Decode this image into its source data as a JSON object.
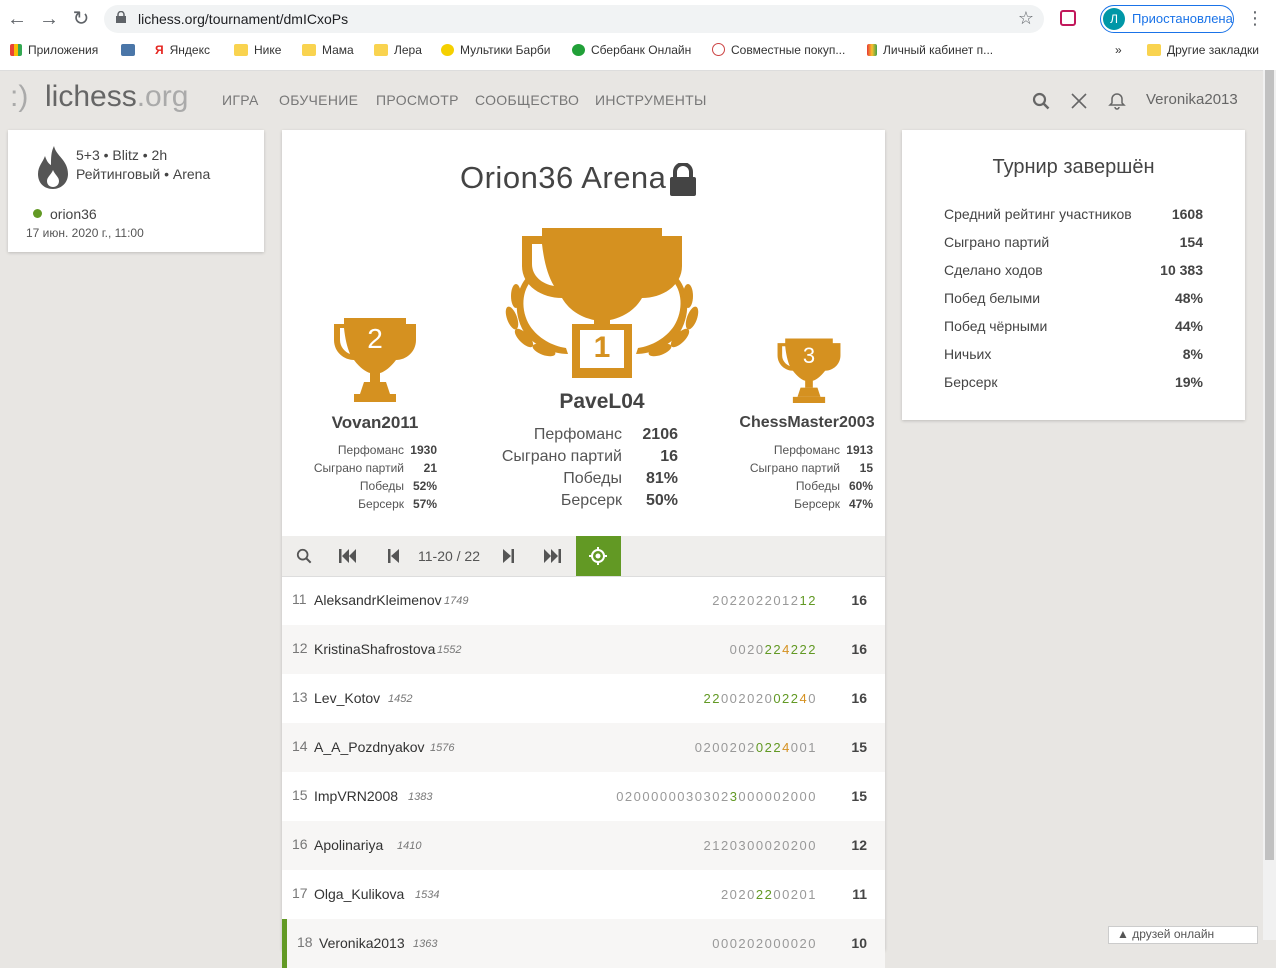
{
  "browser": {
    "url": "lichess.org/tournament/dmICxoPs",
    "profile_initial": "Л",
    "profile_label": "Приостановлена",
    "bookmarks": [
      "Приложения",
      "Яндекс",
      "Нике",
      "Мама",
      "Лера",
      "Мультики Барби",
      "Сбербанк Онлайн",
      "Совместные покуп...",
      "Личный кабинет п...",
      "»",
      "Другие закладки"
    ]
  },
  "site": {
    "logo_smile": ":)",
    "logo_main": "lichess",
    "logo_suffix": ".org",
    "nav": [
      "ИГРА",
      "ОБУЧЕНИЕ",
      "ПРОСМОТР",
      "СООБЩЕСТВО",
      "ИНСТРУМЕНТЫ"
    ],
    "username": "Veronika2013"
  },
  "info": {
    "line1": "5+3 • Blitz • 2h",
    "line2": "Рейтинговый • Arena",
    "creator": "orion36",
    "date": "17 июн. 2020 г., 11:00"
  },
  "tournament": {
    "title": "Orion36 Arena",
    "podium": [
      {
        "place": "1",
        "name": "PaveL04",
        "stats": [
          [
            "Перфоманс",
            "2106"
          ],
          [
            "Сыграно партий",
            "16"
          ],
          [
            "Победы",
            "81%"
          ],
          [
            "Берсерк",
            "50%"
          ]
        ]
      },
      {
        "place": "2",
        "name": "Vovan2011",
        "stats": [
          [
            "Перфоманс",
            "1930"
          ],
          [
            "Сыграно партий",
            "21"
          ],
          [
            "Победы",
            "52%"
          ],
          [
            "Берсерк",
            "57%"
          ]
        ]
      },
      {
        "place": "3",
        "name": "ChessMaster2003",
        "stats": [
          [
            "Перфоманс",
            "1913"
          ],
          [
            "Сыграно партий",
            "15"
          ],
          [
            "Победы",
            "60%"
          ],
          [
            "Берсерк",
            "47%"
          ]
        ]
      }
    ],
    "pager": "11-20 / 22",
    "rows": [
      {
        "rank": "11",
        "name": "AleksandrKleimenov",
        "rating": "1749",
        "sheet": "20220220121 2",
        "score": "16"
      },
      {
        "rank": "12",
        "name": "KristinaShafrostova",
        "rating": "1552",
        "sheet": "00202242 2 2",
        "score": "16"
      },
      {
        "rank": "13",
        "name": "Lev_Kotov",
        "rating": "1452",
        "sheet": "2200202002240",
        "score": "16"
      },
      {
        "rank": "14",
        "name": "A_A_Pozdnyakov",
        "rating": "1576",
        "sheet": "02002020224001",
        "score": "15"
      },
      {
        "rank": "15",
        "name": "ImpVRN2008",
        "rating": "1383",
        "sheet": "020000003030230000 02000",
        "score": "15"
      },
      {
        "rank": "16",
        "name": "Apolinariya",
        "rating": "1410",
        "sheet": "2120300020200",
        "score": "12"
      },
      {
        "rank": "17",
        "name": "Olga_Kulikova",
        "rating": "1534",
        "sheet": "20202200201",
        "score": "11"
      },
      {
        "rank": "18",
        "name": "Veronika2013",
        "rating": "1363",
        "sheet": "000202000020",
        "score": "10"
      }
    ]
  },
  "summary": {
    "title": "Турнир завершён",
    "stats": [
      [
        "Средний рейтинг участников",
        "1608"
      ],
      [
        "Сыграно партий",
        "154"
      ],
      [
        "Сделано ходов",
        "10 383"
      ],
      [
        "Побед белыми",
        "48%"
      ],
      [
        "Побед чёрными",
        "44%"
      ],
      [
        "Ничьих",
        "8%"
      ],
      [
        "Берсерк",
        "19%"
      ]
    ]
  },
  "friends_label": "друзей онлайн",
  "colors": {
    "accent": "#629924",
    "gold": "#d59120"
  }
}
